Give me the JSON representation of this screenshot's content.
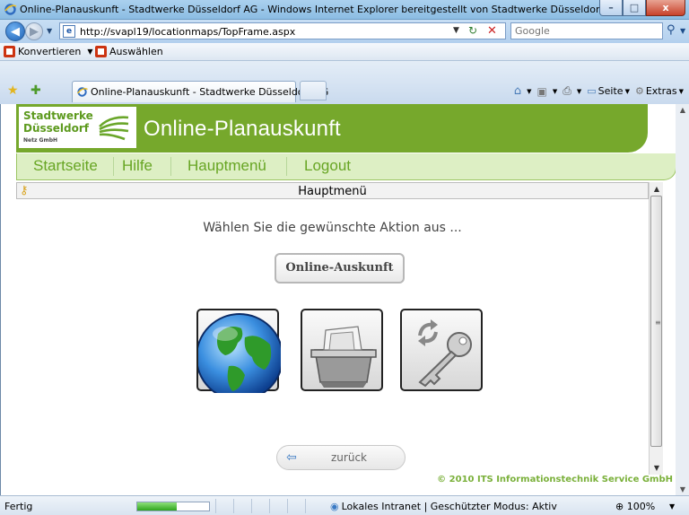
{
  "window": {
    "title": "Online-Planauskunft - Stadtwerke Düsseldorf AG - Windows Internet Explorer bereitgestellt von Stadtwerke Düsseldorf AG",
    "minimize": "–",
    "maximize": "□",
    "close": "x"
  },
  "address": {
    "url": "http://svapl19/locationmaps/TopFrame.aspx",
    "search_placeholder": "Google"
  },
  "convert_toolbar": {
    "convert_label": "Konvertieren",
    "select_label": "Auswählen"
  },
  "tabs": {
    "active_tab": "Online-Planauskunft - Stadtwerke Düsseldorf AG",
    "commands": {
      "page": "Seite",
      "extras": "Extras"
    }
  },
  "site": {
    "logo_line1": "Stadtwerke",
    "logo_line2": "Düsseldorf",
    "logo_line3": "Netz GmbH",
    "app_title": "Online-Planauskunft",
    "nav": [
      "Startseite",
      "Hilfe",
      "Hauptmenü",
      "Logout"
    ],
    "section_title": "Hauptmenü",
    "prompt": "Wählen Sie die gewünschte Aktion aus ...",
    "online_button": "Online-Auskunft",
    "tiles": [
      "globe-icon",
      "archive-box-icon",
      "key-sync-icon"
    ],
    "back_button": "zurück",
    "copyright": "© 2010 ITS Informationstechnik Service GmbH"
  },
  "status": {
    "text": "Fertig",
    "progress": 0.55,
    "zone": "Lokales Intranet | Geschützter Modus: Aktiv",
    "zoom": "100%"
  },
  "colors": {
    "brand_green": "#76a82c",
    "nav_green": "#67a523",
    "nav_band": "#ddefc4"
  }
}
